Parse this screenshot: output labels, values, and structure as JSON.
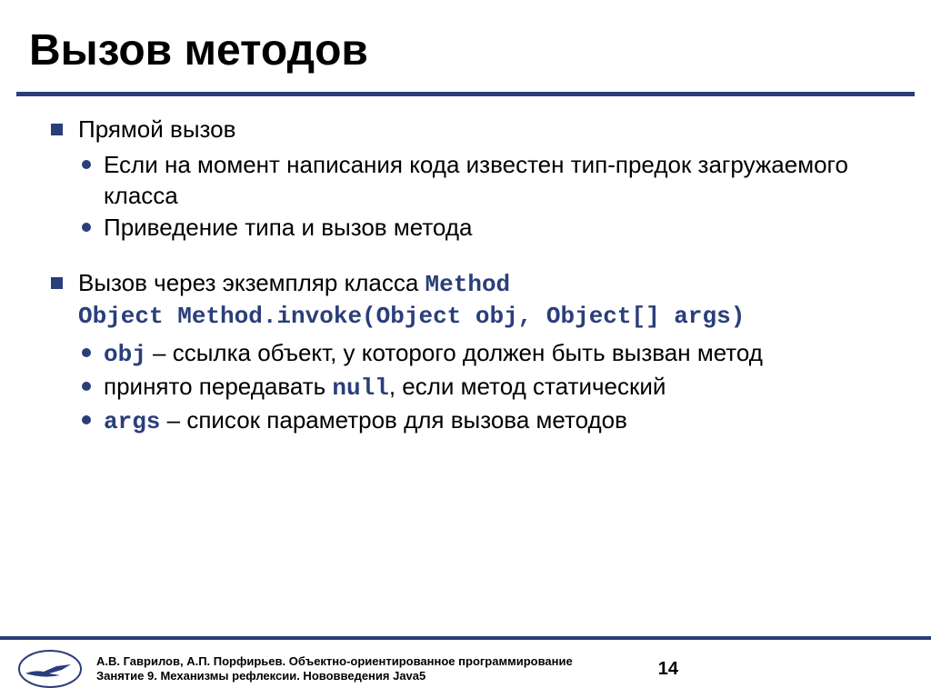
{
  "title": "Вызов методов",
  "bullets": {
    "b1": "Прямой вызов",
    "b1a": "Если на момент написания кода известен тип-предок загружаемого класса",
    "b1b": "Приведение типа и вызов метода",
    "b2_pre": "Вызов через экземпляр класса ",
    "b2_code1": "Method",
    "b2_code2": "Object Method.invoke(Object obj, Object[] args)",
    "b2a_code": "obj",
    "b2a_rest": " – ссылка объект, у которого должен быть вызван метод",
    "b2b_pre": "принято передавать ",
    "b2b_code": "null",
    "b2b_post": ", если метод статический",
    "b2c_code": "args",
    "b2c_rest": " – список параметров для вызова методов"
  },
  "footer": {
    "line1": "А.В. Гаврилов, А.П. Порфирьев. Объектно-ориентированное программирование",
    "line2": "Занятие 9. Механизмы рефлексии. Нововведения Java5"
  },
  "pageNumber": "14"
}
